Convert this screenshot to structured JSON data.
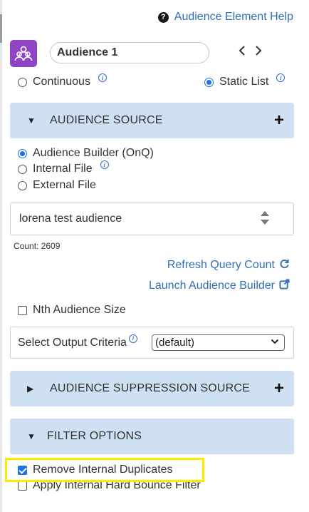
{
  "header": {
    "help_label": "Audience Element Help",
    "help_icon": "question-circle-icon"
  },
  "audience": {
    "icon": "users-group-icon",
    "icon_color": "#8e44c4",
    "name_value": "Audience 1",
    "prev_label": "‹",
    "next_label": "›"
  },
  "mode": {
    "continuous_label": "Continuous",
    "static_list_label": "Static List",
    "selected": "Static List"
  },
  "audience_source": {
    "title": "AUDIENCE SOURCE",
    "expanded": true,
    "options": [
      {
        "label": "Audience Builder (OnQ)",
        "selected": true
      },
      {
        "label": "Internal File",
        "selected": false
      },
      {
        "label": "External File",
        "selected": false
      }
    ],
    "selected_audience": "lorena test audience",
    "count_text": "Count: 2609",
    "refresh_label": "Refresh Query Count",
    "launch_label": "Launch Audience Builder",
    "nth_label": "Nth Audience Size",
    "nth_checked": false,
    "output_criteria_label": "Select Output Criteria",
    "output_criteria_value": "(default)"
  },
  "suppression": {
    "title": "AUDIENCE SUPPRESSION SOURCE",
    "expanded": false
  },
  "filter_options": {
    "title": "FILTER OPTIONS",
    "expanded": true,
    "remove_duplicates_label": "Remove Internal Duplicates",
    "remove_duplicates_checked": true,
    "hard_bounce_label": "Apply Internal Hard Bounce Filter",
    "hard_bounce_checked": false
  },
  "colors": {
    "link": "#2f6fb4",
    "section_bg": "#cfe0f3",
    "accent": "#1a73e8",
    "highlight": "#ffeb00"
  }
}
